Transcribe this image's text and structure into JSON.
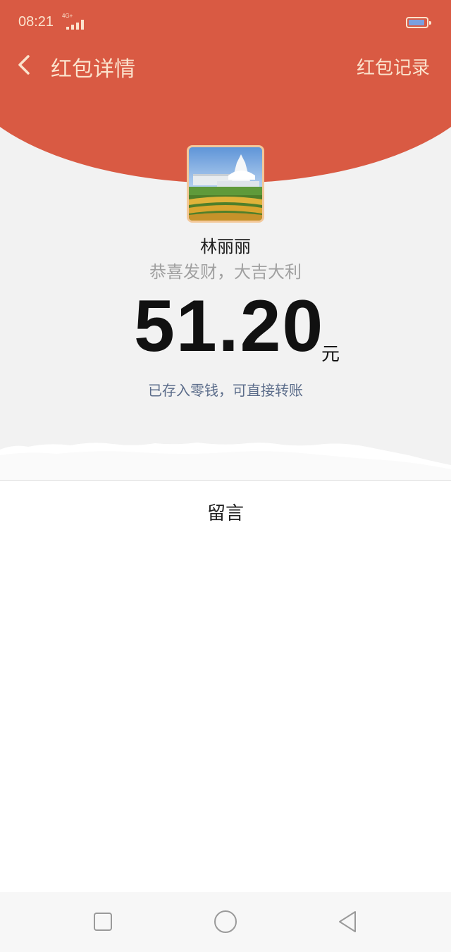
{
  "status_bar": {
    "time": "08:21",
    "network": "4G+",
    "signal_icon": "signal-bars-icon",
    "battery_icon": "battery-icon"
  },
  "nav": {
    "back_icon": "chevron-left-icon",
    "title": "红包详情",
    "records_label": "红包记录"
  },
  "packet": {
    "avatar_description_icon": "avatar-photo",
    "sender_name": "林丽丽",
    "greeting": "恭喜发财，大吉大利",
    "amount": "51.20",
    "currency": "元",
    "stored_note": "已存入零钱，可直接转账"
  },
  "message_section": {
    "label": "留言"
  },
  "system_nav": {
    "recents_icon": "square-icon",
    "home_icon": "circle-icon",
    "back_icon": "triangle-back-icon"
  },
  "colors": {
    "header_red": "#d95a43",
    "header_text": "#fbe3cd",
    "background_gray": "#f2f2f2",
    "note_blue_gray": "#5b6c8a"
  }
}
